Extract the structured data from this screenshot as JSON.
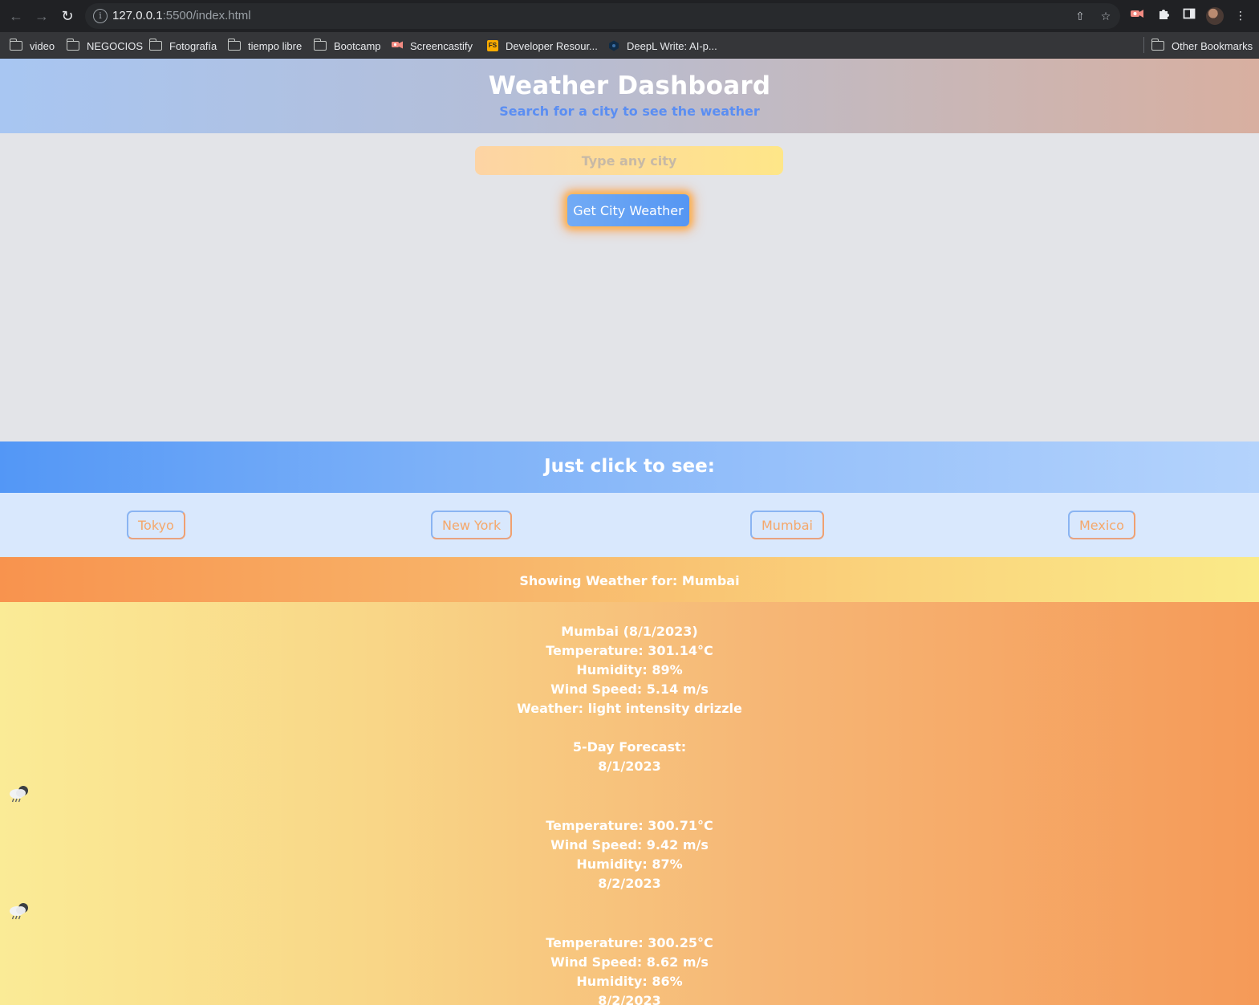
{
  "browser": {
    "url_host": "127.0.0.1",
    "url_path": ":5500/index.html",
    "bookmarks": [
      {
        "label": "video",
        "type": "folder"
      },
      {
        "label": "NEGOCIOS",
        "type": "folder"
      },
      {
        "label": "Fotografía",
        "type": "folder"
      },
      {
        "label": "tiempo libre",
        "type": "folder"
      },
      {
        "label": "Bootcamp",
        "type": "folder"
      },
      {
        "label": "Screencastify",
        "type": "screencastify-icon"
      },
      {
        "label": "Developer Resour...",
        "type": "fs-icon"
      },
      {
        "label": "DeepL Write: AI-p...",
        "type": "deepl-icon"
      }
    ],
    "other_bookmarks": "Other Bookmarks"
  },
  "header": {
    "title": "Weather Dashboard",
    "subtitle": "Search for a city to see the weather"
  },
  "search": {
    "placeholder": "Type any city",
    "button_label": "Get City Weather"
  },
  "quick": {
    "title": "Just click to see:",
    "cities": [
      "Tokyo",
      "New York",
      "Mumbai",
      "Mexico"
    ]
  },
  "showing": "Showing Weather for: Mumbai",
  "current": {
    "heading": "Mumbai (8/1/2023)",
    "temperature": "Temperature: 301.14°C",
    "humidity": "Humidity: 89%",
    "wind": "Wind Speed: 5.14 m/s",
    "weather": "Weather: light intensity drizzle"
  },
  "forecast": {
    "title": "5-Day Forecast:",
    "days": [
      {
        "date": "8/1/2023",
        "icon": "rain-cloud-icon",
        "temperature": "Temperature: 300.71°C",
        "wind": "Wind Speed: 9.42 m/s",
        "humidity": "Humidity: 87%"
      },
      {
        "date": "8/2/2023",
        "icon": "rain-cloud-icon",
        "temperature": "Temperature: 300.25°C",
        "wind": "Wind Speed: 8.62 m/s",
        "humidity": "Humidity: 86%"
      },
      {
        "date": "8/2/2023"
      }
    ]
  },
  "colors": {
    "accent_blue": "#5596f3",
    "accent_orange": "#f8934e",
    "accent_yellow": "#faea88"
  }
}
